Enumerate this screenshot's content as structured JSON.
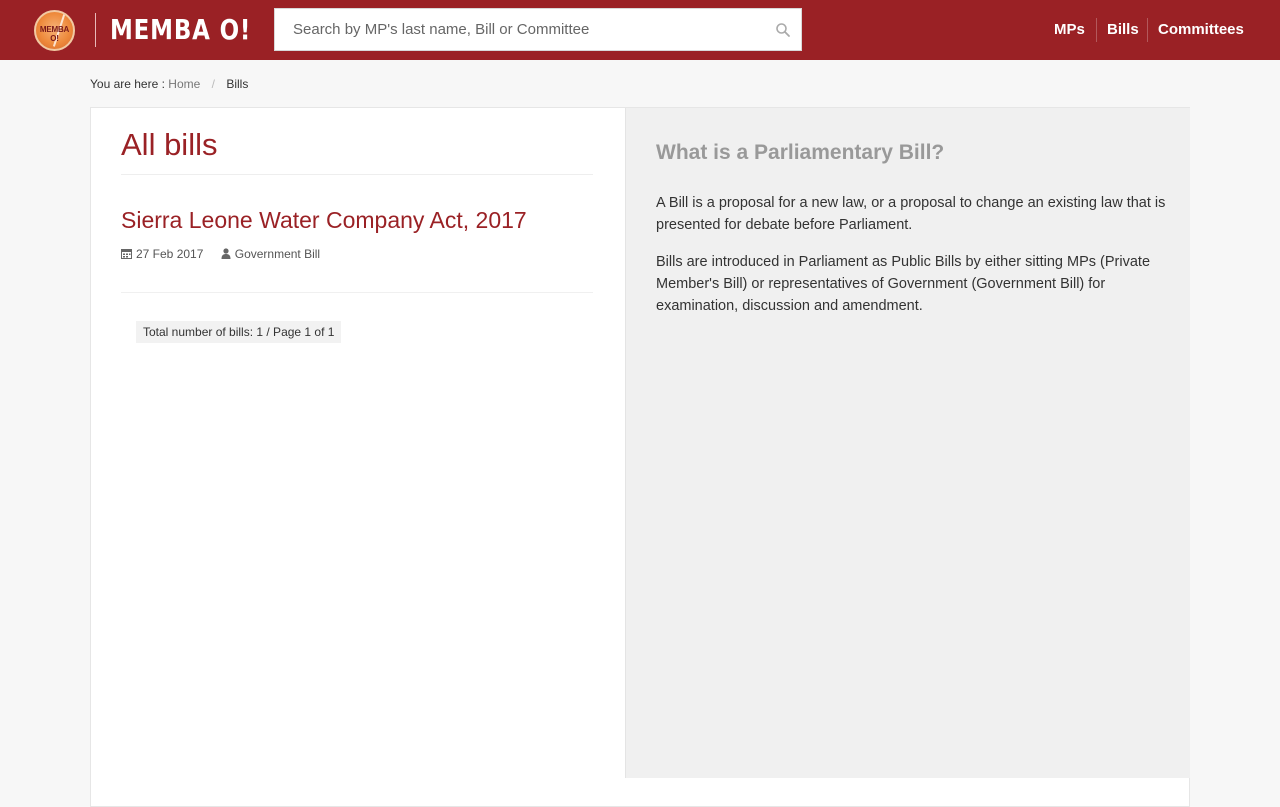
{
  "header": {
    "logo_text": "MEMBA O!",
    "brand": "MEMBA O!",
    "search_placeholder": "Search by MP's last name, Bill or Committee",
    "nav": [
      "MPs",
      "Bills",
      "Committees"
    ]
  },
  "breadcrumb": {
    "prefix": "You are here :",
    "home": "Home",
    "divider": "/",
    "current": "Bills"
  },
  "main": {
    "title": "All bills",
    "bills": [
      {
        "title": "Sierra Leone Water Company Act, 2017",
        "date": "27 Feb 2017",
        "type": "Government Bill"
      }
    ],
    "total": "Total number of bills: 1 / Page 1 of 1"
  },
  "sidebar": {
    "title": "What is a Parliamentary Bill?",
    "paragraphs": [
      "A Bill is a proposal for a new law, or a proposal to change an existing law that is presented for debate before Parliament.",
      "Bills are introduced in Parliament as Public Bills by either sitting MPs (Private Member's Bill) or representatives of Government (Government Bill) for examination, discussion and amendment."
    ]
  },
  "colors": {
    "brand": "#9a2125",
    "accent_title": "#9a2125",
    "muted_title": "#999999"
  },
  "icons": [
    "search-icon",
    "calendar-icon",
    "user-icon"
  ]
}
